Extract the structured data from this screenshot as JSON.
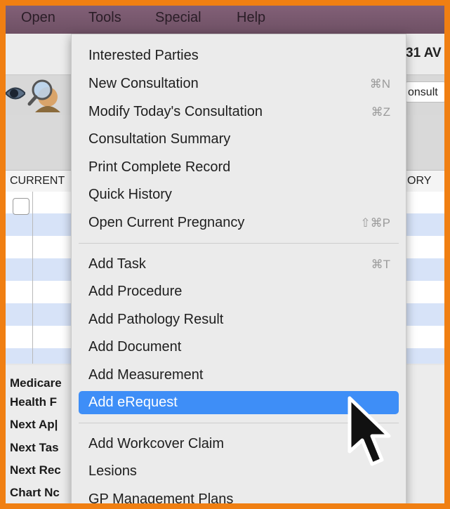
{
  "menubar": {
    "items": [
      "Open",
      "Tools",
      "Special",
      "Help"
    ]
  },
  "window": {
    "top_right_text": "31 AV",
    "consult_field_value": "onsult",
    "col_headers": {
      "current": "CURRENT",
      "history": "ORY"
    },
    "info_labels": [
      "Medicare",
      "Health F",
      "Next Ap|",
      "Next Tas",
      "Next Rec",
      "Chart Nc"
    ]
  },
  "tools_menu": {
    "groups": [
      [
        {
          "label": "Interested Parties",
          "shortcut": ""
        },
        {
          "label": "New Consultation",
          "shortcut": "⌘N"
        },
        {
          "label": "Modify Today's Consultation",
          "shortcut": "⌘Z"
        },
        {
          "label": "Consultation Summary",
          "shortcut": ""
        },
        {
          "label": "Print Complete Record",
          "shortcut": ""
        },
        {
          "label": "Quick History",
          "shortcut": ""
        },
        {
          "label": "Open Current Pregnancy",
          "shortcut": "⇧⌘P"
        }
      ],
      [
        {
          "label": "Add Task",
          "shortcut": "⌘T"
        },
        {
          "label": "Add Procedure",
          "shortcut": ""
        },
        {
          "label": "Add Pathology Result",
          "shortcut": ""
        },
        {
          "label": "Add Document",
          "shortcut": ""
        },
        {
          "label": "Add Measurement",
          "shortcut": ""
        },
        {
          "label": "Add eRequest",
          "shortcut": "",
          "selected": true
        }
      ],
      [
        {
          "label": "Add Workcover Claim",
          "shortcut": ""
        },
        {
          "label": "Lesions",
          "shortcut": ""
        },
        {
          "label": "GP Management Plans",
          "shortcut": ""
        }
      ]
    ]
  },
  "colors": {
    "frame_border": "#f07f12",
    "menubar": "#7a5a70",
    "selection": "#3e8ef7",
    "row_alt": "#d7e3f8"
  },
  "icons": [
    "eye-icon",
    "search-person-icon",
    "mouse-pointer-icon"
  ]
}
